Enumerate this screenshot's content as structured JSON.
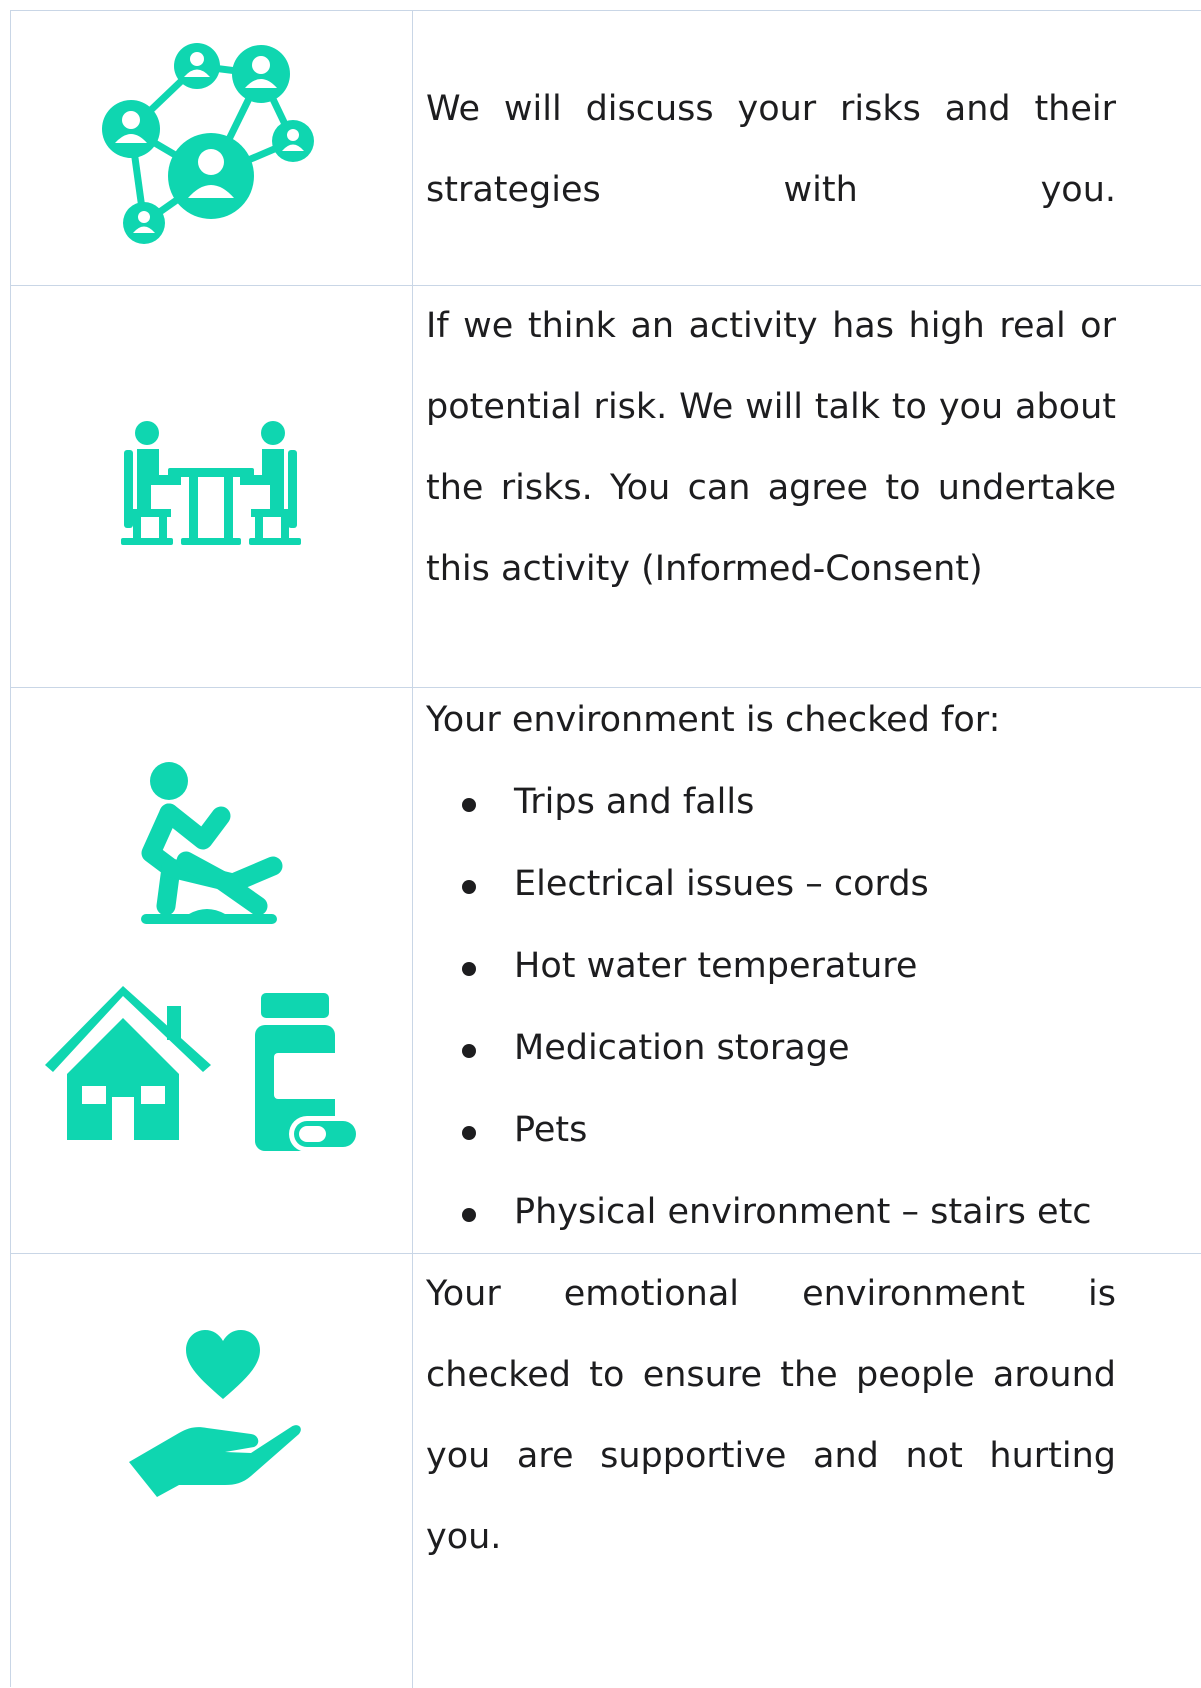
{
  "accent_color": "#0fd6b0",
  "rows": [
    {
      "icon": "people-network-icon",
      "text": "We will discuss your risks and their strategies with you."
    },
    {
      "icon": "meeting-table-icon",
      "text": "If we think an activity has high real or potential risk. We will talk to you about the risks. You can agree to undertake this activity (Informed-Consent)"
    },
    {
      "icons": [
        "slip-fall-icon",
        "house-icon",
        "medication-bottle-icon"
      ],
      "intro": "Your environment is checked for:",
      "items": [
        "Trips and falls",
        "Electrical issues – cords",
        "Hot water temperature",
        "Medication storage",
        "Pets",
        "Physical environment – stairs etc"
      ]
    },
    {
      "icon": "heart-in-hand-icon",
      "text": "Your emotional environment is checked to ensure the people around you are supportive and not hurting you."
    }
  ]
}
